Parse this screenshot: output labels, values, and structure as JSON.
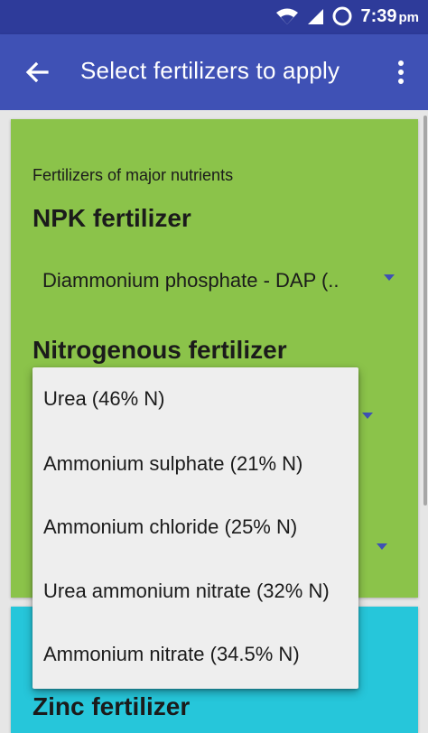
{
  "status_bar": {
    "time": "7:39",
    "ampm": "pm",
    "icons": [
      "wifi-icon",
      "signal-icon",
      "battery-ring-icon"
    ]
  },
  "app_bar": {
    "title": "Select fertilizers to apply",
    "back_icon": "arrow-back-icon",
    "menu_icon": "overflow-menu-icon"
  },
  "major_card": {
    "section_label": "Fertilizers of major nutrients",
    "npk": {
      "heading": "NPK fertilizer",
      "selected": "Diammonium phosphate - DAP (.."
    },
    "nitrogenous": {
      "heading": "Nitrogenous fertilizer"
    }
  },
  "zinc_card": {
    "heading": "Zinc fertilizer"
  },
  "dropdown": {
    "options": [
      "Urea (46% N)",
      "Ammonium sulphate (21% N)",
      "Ammonium chloride (25% N)",
      "Urea ammonium nitrate (32% N)",
      "Ammonium nitrate (34.5% N)"
    ]
  },
  "colors": {
    "status_bar": "#2e3b9a",
    "app_bar": "#3f51b5",
    "major_card": "#8bc34a",
    "zinc_card": "#26c6da",
    "caret": "#3f51b5",
    "dropdown_bg": "#eeeeee"
  }
}
